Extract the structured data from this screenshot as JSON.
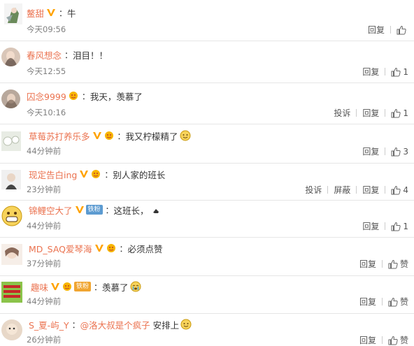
{
  "labels": {
    "reply": "回复",
    "report": "投诉",
    "block": "屏蔽",
    "zan": "赞"
  },
  "comments": [
    {
      "user": "鳌甜",
      "text": "牛",
      "time": "今天09:56",
      "likes": ""
    },
    {
      "user": "春风想念",
      "text": "泪目！！",
      "time": "今天12:55",
      "likes": "1"
    },
    {
      "user": "囚念9999",
      "text": "我天，羡慕了",
      "time": "今天10:16",
      "likes": "1"
    },
    {
      "user": "草莓苏打养乐多",
      "text": "我又柠檬精了",
      "time": "44分钟前",
      "likes": "3"
    },
    {
      "user": "现定告白ing",
      "text": "别人家的班长",
      "time": "23分钟前",
      "likes": "4"
    },
    {
      "user": "锦鲤空大了",
      "fan": "铁粉",
      "text": "这班长，",
      "time": "44分钟前",
      "likes": "1"
    },
    {
      "user": "MD_SAQ爱琴海",
      "text": "必须点赞",
      "time": "37分钟前",
      "likes": "赞"
    },
    {
      "user": "趣味",
      "fan": "铁粉",
      "text": "羡慕了",
      "time": "44分钟前",
      "likes": "赞"
    },
    {
      "user": "S_夏-屿_Y",
      "mention": "@洛大叔是个疯子",
      "text": "安排上",
      "time": "26分钟前",
      "likes": "赞"
    }
  ],
  "colors": {
    "username": "#eb7350",
    "fan_badge": "#5c9bd1",
    "vip_badge": "#f0a531"
  },
  "icons": [
    "v-badge",
    "vip-badge",
    "thumbs-up-icon",
    "smile-emoji",
    "cry-emoji",
    "hand-emoji"
  ]
}
